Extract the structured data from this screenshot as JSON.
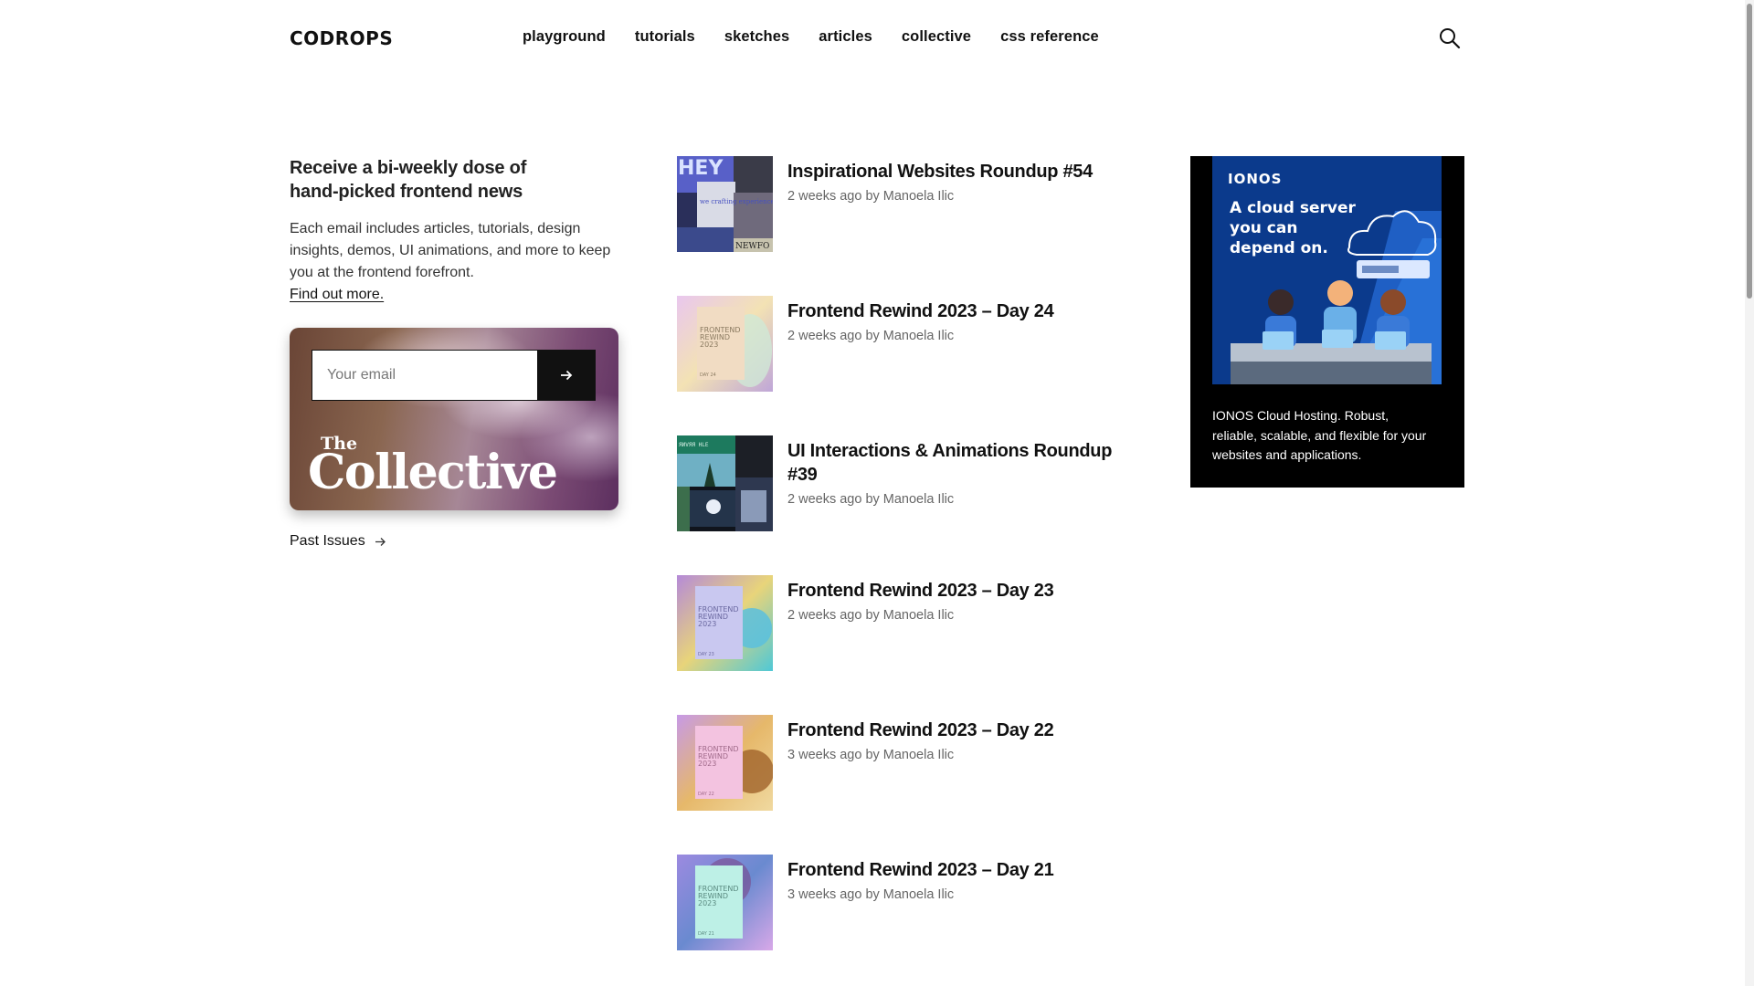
{
  "header": {
    "logo": "CODROPS",
    "nav": [
      "playground",
      "tutorials",
      "sketches",
      "articles",
      "collective",
      "css reference"
    ],
    "search_icon": "search-icon"
  },
  "newsletter": {
    "heading_line1": "Receive a bi-weekly dose of",
    "heading_line2": "hand-picked frontend news",
    "description": "Each email includes articles, tutorials, design insights, demos, UI animations, and more to keep you at the frontend forefront.",
    "link": "Find out more.",
    "email_placeholder": "Your email",
    "submit_icon": "arrow-right-icon",
    "collective_the": "The",
    "collective_name": "Collective",
    "past_issues": "Past Issues"
  },
  "posts": [
    {
      "title": "Inspirational Websites Roundup #54",
      "meta": "2 weeks ago by Manoela Ilic"
    },
    {
      "title": "Frontend Rewind 2023 – Day 24",
      "meta": "2 weeks ago by Manoela Ilic"
    },
    {
      "title": "UI Interactions & Animations Roundup #39",
      "meta": "2 weeks ago by Manoela Ilic"
    },
    {
      "title": "Frontend Rewind 2023 – Day 23",
      "meta": "2 weeks ago by Manoela Ilic"
    },
    {
      "title": "Frontend Rewind 2023 – Day 22",
      "meta": "3 weeks ago by Manoela Ilic"
    },
    {
      "title": "Frontend Rewind 2023 – Day 21",
      "meta": "3 weeks ago by Manoela Ilic"
    }
  ],
  "thumb_text": {
    "hey": "HEY",
    "we_craft": "we crafting experiences",
    "newfo": "NEWFO",
    "frontend": "FRONTEND",
    "rewind": "REWIND",
    "year": "2023",
    "day24": "DAY 24",
    "day23": "DAY 23",
    "day22": "DAY 22",
    "day21": "DAY 21"
  },
  "ad": {
    "brand": "IONOS",
    "headline_1": "A cloud server",
    "headline_2": "you can",
    "headline_3": "depend on.",
    "text": "IONOS Cloud Hosting. Robust, reliable, scalable, and flexible for your websites and applications."
  },
  "colors": {
    "text": "#111111",
    "meta": "#666666",
    "ad_bg": "#000000",
    "ad_blue": "#0b3a8c"
  }
}
